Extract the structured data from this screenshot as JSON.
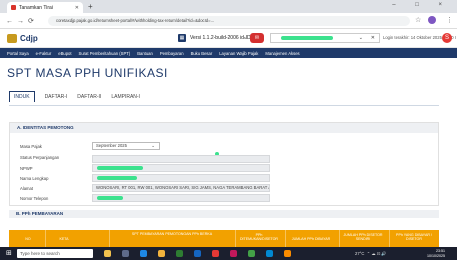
{
  "browser": {
    "tab_title": "Tanamkan Tirai",
    "url": "coretaxdjp.pajak.go.id/returnsheet-portal/#/withholding-tax-return/detail?id=&docId=...",
    "new_tab": "+",
    "window_controls": "–  □  ×"
  },
  "header": {
    "logo": "Cdjp",
    "version": "Versi 1.1.2-build-2006  id-ID",
    "login_time": "Login terakhir: 14 Oktober 2025 23:50 I",
    "user_initial": "S"
  },
  "menu": [
    "Portal Saya",
    "e-Faktur",
    "eBupot",
    "Surat Pemberitahuan (SPT)",
    "Bantuan",
    "Pembayaran",
    "Buku Besar",
    "Layanan Wajib Pajak",
    "Manajemen Akses"
  ],
  "page": {
    "title": "SPT MASA PPH UNIFIKASI",
    "tabs": [
      "INDUK",
      "DAFTAR-I",
      "DAFTAR-II",
      "LAMPIRAN-I"
    ]
  },
  "identity": {
    "header": "A. IDENTITAS PEMOTONG",
    "labels": [
      "Masa Pajak",
      "Status Perpanjangan",
      "NPWP",
      "Nama Lengkap",
      "Alamat",
      "Nomor Telepon"
    ],
    "masa_pajak": "September 2025",
    "alamat": "WONOSARI, RT 001, RW 001, WONOSARI SARI, SIG JAMS, NAGA TERAMBANG BARAT AL"
  },
  "section_b": "B. PPh PEMBAYARAN",
  "table": {
    "headers": [
      "NO",
      "KETA",
      "SPT PEMBAYARAN PEMOTONGAN PPh BERKA",
      "PPh DITEMUKAN/DISETOR",
      "JUMLAH PPh DIBAYAR",
      "JUMLAH PPh DISETOR SENDIRI",
      "PPh YANG DIBAYAR / DISETOR"
    ]
  },
  "taskbar": {
    "search": "Type here to search",
    "weather": "27°C",
    "time": "23:51",
    "date": "10/10/2025"
  }
}
